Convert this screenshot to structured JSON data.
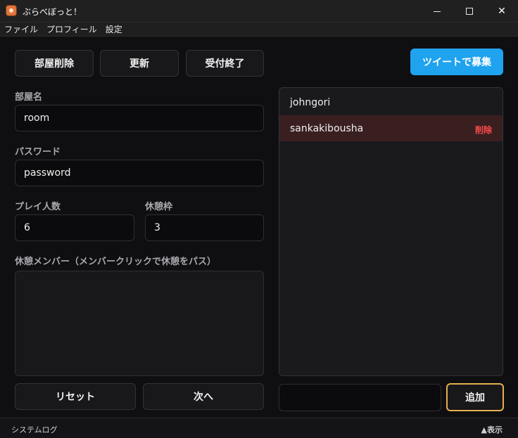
{
  "window": {
    "title": "ぶらべぼっと！",
    "close_glyph": "✕"
  },
  "menu": {
    "items": [
      "ファイル",
      "プロフィール",
      "設定"
    ]
  },
  "toolbar": {
    "delete_room": "部屋削除",
    "refresh": "更新",
    "close_reception": "受付終了",
    "tweet": "ツイートで募集"
  },
  "form": {
    "room_name_label": "部屋名",
    "room_name_value": "room",
    "password_label": "パスワード",
    "password_value": "password",
    "players_label": "プレイ人数",
    "players_value": "6",
    "break_label": "休憩枠",
    "break_value": "3",
    "break_members_label": "休憩メンバー（メンバークリックで休憩をパス）"
  },
  "actions": {
    "reset": "リセット",
    "next": "次へ",
    "add": "追加"
  },
  "members": {
    "items": [
      {
        "name": "johngori",
        "selected": false
      },
      {
        "name": "sankakibousha",
        "selected": true,
        "delete_label": "削除"
      }
    ]
  },
  "add_input": {
    "value": ""
  },
  "statusbar": {
    "log_label": "システムログ",
    "toggle_label": "▲表示"
  },
  "colors": {
    "accent": "#1fa3ef",
    "danger": "#ff4b4b",
    "focus": "#e6b04d",
    "background": "#0f0f11"
  },
  "icons": {
    "app": "app-mascot-icon"
  }
}
